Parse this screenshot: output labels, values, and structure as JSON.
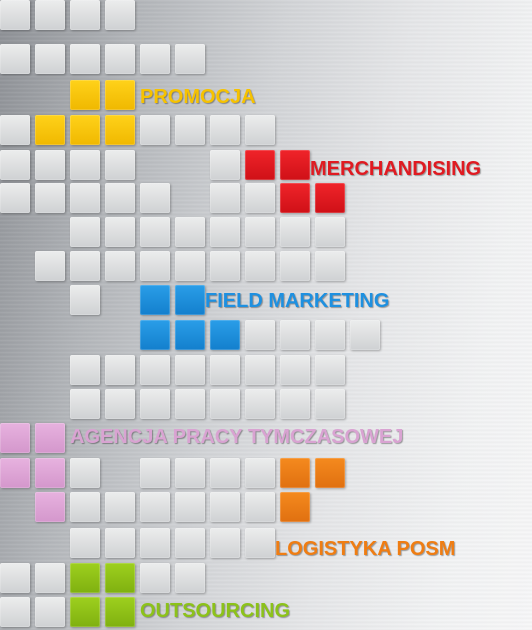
{
  "colors": {
    "yellow": "#f6c200",
    "red": "#e01a21",
    "blue": "#1e90e0",
    "pink": "#d9a3d2",
    "orange": "#ef7d13",
    "green": "#8cc21a",
    "grey": "#d9dbdd"
  },
  "labels": {
    "promocja": "PROMOCJA",
    "merchandising": "MERCHANDISING",
    "field_marketing": "FIELD MARKETING",
    "agencja": "AGENCJA PRACY TYMCZASOWEJ",
    "logistyka": "LOGISTYKA POSM",
    "outsourcing": "OUTSOURCING"
  }
}
